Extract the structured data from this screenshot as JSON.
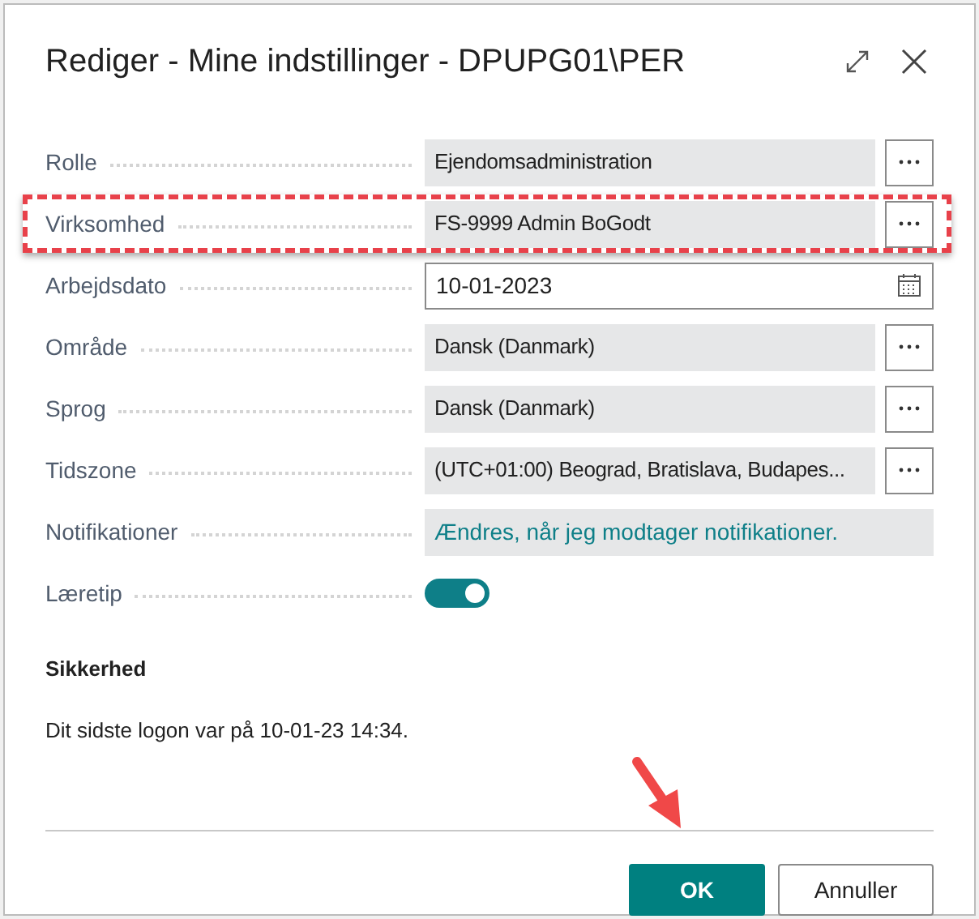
{
  "window": {
    "title": "Rediger - Mine indstillinger - DPUPG01\\PER"
  },
  "fields": [
    {
      "kind": "lookup",
      "label": "Rolle",
      "value": "Ejendomsadministration",
      "highlighted": false
    },
    {
      "kind": "lookup",
      "label": "Virksomhed",
      "value": "FS-9999 Admin BoGodt",
      "highlighted": true
    },
    {
      "kind": "date",
      "label": "Arbejdsdato",
      "value": "10-01-2023",
      "highlighted": false
    },
    {
      "kind": "lookup",
      "label": "Område",
      "value": "Dansk (Danmark)",
      "highlighted": false
    },
    {
      "kind": "lookup",
      "label": "Sprog",
      "value": "Dansk (Danmark)",
      "highlighted": false
    },
    {
      "kind": "lookup",
      "label": "Tidszone",
      "value": "(UTC+01:00) Beograd, Bratislava, Budapes...",
      "highlighted": false
    },
    {
      "kind": "link",
      "label": "Notifikationer",
      "value": "Ændres, når jeg modtager notifikationer.",
      "highlighted": false
    },
    {
      "kind": "toggle",
      "label": "Læretip",
      "on": true,
      "highlighted": false
    }
  ],
  "security": {
    "heading": "Sikkerhed",
    "text": "Dit sidste logon var på 10-01-23 14:34."
  },
  "buttons": [
    {
      "label": "OK",
      "primary": true
    },
    {
      "label": "Annuller",
      "primary": false
    }
  ]
}
